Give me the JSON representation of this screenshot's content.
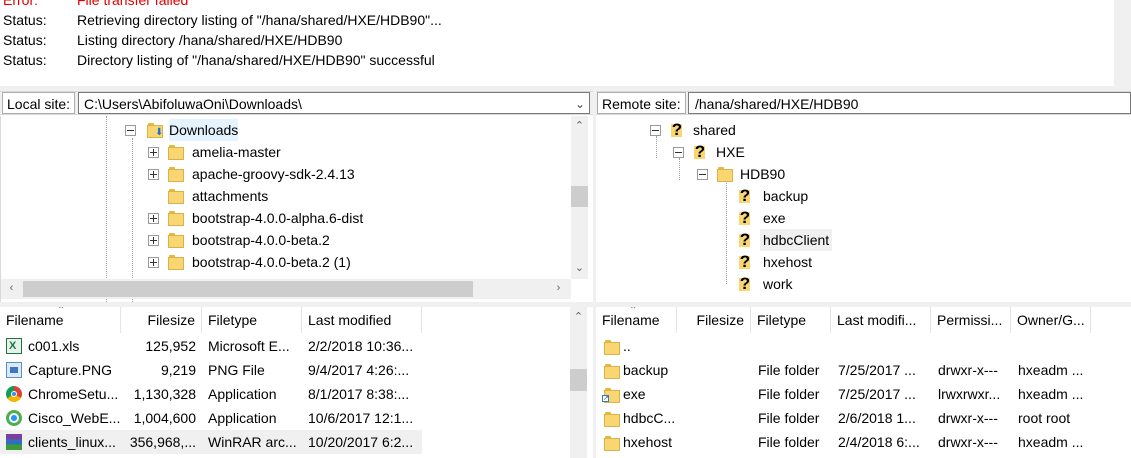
{
  "log": [
    {
      "label": "Error:",
      "text": "File transfer failed",
      "error": true
    },
    {
      "label": "Status:",
      "text": "Retrieving directory listing of \"/hana/shared/HXE/HDB90\"..."
    },
    {
      "label": "Status:",
      "text": "Listing directory /hana/shared/HXE/HDB90"
    },
    {
      "label": "Status:",
      "text": "Directory listing of \"/hana/shared/HXE/HDB90\" successful"
    }
  ],
  "local": {
    "site_label": "Local site:",
    "path": "C:\\Users\\AbifoluwaOni\\Downloads\\",
    "tree": [
      {
        "label": "Downloads"
      },
      {
        "label": "amelia-master"
      },
      {
        "label": "apache-groovy-sdk-2.4.13"
      },
      {
        "label": "attachments"
      },
      {
        "label": "bootstrap-4.0.0-alpha.6-dist"
      },
      {
        "label": "bootstrap-4.0.0-beta.2"
      },
      {
        "label": "bootstrap-4.0.0-beta.2 (1)"
      }
    ],
    "columns": {
      "filename": "Filename",
      "filesize": "Filesize",
      "filetype": "Filetype",
      "modified": "Last modified"
    },
    "files": [
      {
        "name": "c001.xls",
        "size": "125,952",
        "type": "Microsoft E...",
        "modified": "2/2/2018 10:36..."
      },
      {
        "name": "Capture.PNG",
        "size": "9,219",
        "type": "PNG File",
        "modified": "9/4/2017 4:26:..."
      },
      {
        "name": "ChromeSetu...",
        "size": "1,130,328",
        "type": "Application",
        "modified": "8/1/2017 8:38:..."
      },
      {
        "name": "Cisco_WebE...",
        "size": "1,004,600",
        "type": "Application",
        "modified": "10/6/2017 12:1..."
      },
      {
        "name": "clients_linux...",
        "size": "356,968,...",
        "type": "WinRAR arc...",
        "modified": "10/20/2017 6:2..."
      }
    ]
  },
  "remote": {
    "site_label": "Remote site:",
    "path": "/hana/shared/HXE/HDB90",
    "tree": [
      {
        "label": "shared"
      },
      {
        "label": "HXE"
      },
      {
        "label": "HDB90"
      },
      {
        "label": "backup"
      },
      {
        "label": "exe"
      },
      {
        "label": "hdbcClient"
      },
      {
        "label": "hxehost"
      },
      {
        "label": "work"
      }
    ],
    "columns": {
      "filename": "Filename",
      "filesize": "Filesize",
      "filetype": "Filetype",
      "modified": "Last modifi...",
      "permissions": "Permissi...",
      "owner": "Owner/G..."
    },
    "files": [
      {
        "name": "..",
        "type": "",
        "modified": "",
        "perm": "",
        "owner": ""
      },
      {
        "name": "backup",
        "type": "File folder",
        "modified": "7/25/2017 ...",
        "perm": "drwxr-x---",
        "owner": "hxeadm ..."
      },
      {
        "name": "exe",
        "type": "File folder",
        "modified": "7/25/2017 ...",
        "perm": "lrwxrwxr...",
        "owner": "hxeadm ..."
      },
      {
        "name": "hdbcC...",
        "type": "File folder",
        "modified": "2/6/2018 1...",
        "perm": "drwxr-x---",
        "owner": "root root"
      },
      {
        "name": "hxehost",
        "type": "File folder",
        "modified": "2/4/2018 6:...",
        "perm": "drwxr-x---",
        "owner": "hxeadm ..."
      }
    ]
  }
}
